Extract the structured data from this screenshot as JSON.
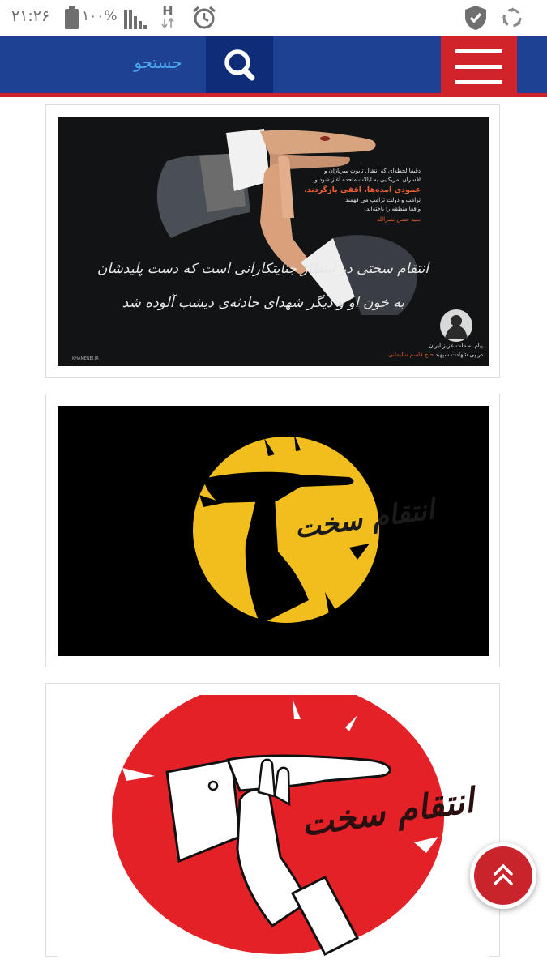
{
  "status_bar": {
    "time": "۲۱:۲۶",
    "battery": "۱۰۰%",
    "icons": [
      "battery-icon",
      "signal-icon",
      "h-network-icon",
      "alarm-icon",
      "shield-check-icon",
      "recycle-icon"
    ]
  },
  "header": {
    "search_label": "جستجو",
    "icons": [
      "menu-icon",
      "search-icon"
    ],
    "colors": {
      "header_bg": "#1e4193",
      "accent_red": "#d0232a",
      "search_label": "#4aa8f0"
    }
  },
  "posts": [
    {
      "text_lines": [
        "دقیقا لحظه‌ای که انتقال تابوت سربازان و",
        "افسران امریکایی به ایالات متحده آغاز شود و"
      ],
      "highlight": "عمودی آمده‌ها، افقی بازگردند،",
      "text_lines_2": [
        "ترامپ و دولت ترامپ می فهمند",
        "واقعا منطقه را باخته‌اند."
      ],
      "quote_author": "سید حسن نصرالله",
      "handwriting_line_1": "انتقام سختی در انتظار جنایتکارانی است که دست پلیدشان",
      "handwriting_line_2": "به خون او و دیگر شهدای حادثه‌ی دیشب آلوده شد",
      "caption_line_1": "پیام به ملت عزیز ایران",
      "caption_line_2_prefix": "در پی شهادت سپهبد",
      "caption_line_2_name": "حاج قاسم سلیمانی",
      "site_logo": "KHAMENEI.IR"
    },
    {
      "slogan": "انتقام سخت",
      "colors": {
        "circle": "#f2be1d",
        "background": "#000000"
      }
    },
    {
      "slogan": "انتقام سخت",
      "colors": {
        "circle": "#e32127",
        "background": "#ffffff"
      }
    }
  ]
}
